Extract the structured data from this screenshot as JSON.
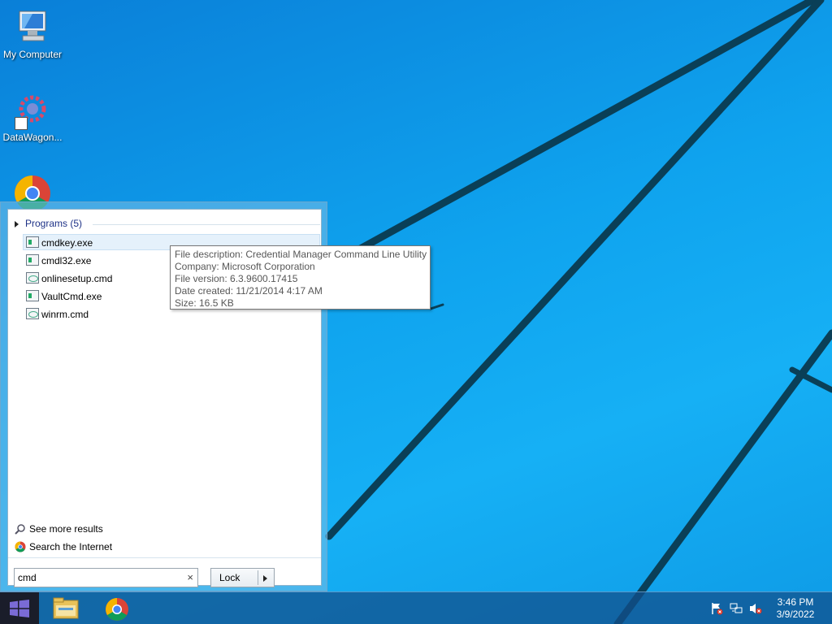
{
  "desktop": {
    "icons": [
      {
        "label": "My Computer",
        "icon": "computer-icon"
      },
      {
        "label": "DataWagon...",
        "icon": "gear-shortcut-icon"
      },
      {
        "label": "",
        "icon": "chrome-icon"
      }
    ]
  },
  "start_menu": {
    "programs_header": "Programs (5)",
    "programs": [
      {
        "label": "cmdkey.exe",
        "icon": "exe-icon",
        "selected": true
      },
      {
        "label": "cmdl32.exe",
        "icon": "exe-icon"
      },
      {
        "label": "onlinesetup.cmd",
        "icon": "cmd-script-icon"
      },
      {
        "label": "VaultCmd.exe",
        "icon": "exe-icon"
      },
      {
        "label": "winrm.cmd",
        "icon": "cmd-script-icon"
      }
    ],
    "tooltip": {
      "description": "File description: Credential Manager Command Line Utility",
      "company": "Company: Microsoft Corporation",
      "version": "File version: 6.3.9600.17415",
      "created": "Date created: 11/21/2014 4:17 AM",
      "size": "Size: 16.5 KB"
    },
    "see_more": "See more results",
    "search_internet": "Search the Internet",
    "search_value": "cmd",
    "clear_symbol": "×",
    "lock_label": "Lock"
  },
  "taskbar": {
    "apps": [
      "file-explorer-icon",
      "chrome-icon"
    ],
    "tray_icons": [
      "action-center-flag-icon",
      "network-icon",
      "volume-muted-icon"
    ],
    "time": "3:46 PM",
    "date": "3/9/2022"
  },
  "colors": {
    "wallpaper": "#0fa3ee",
    "programs_header": "#1e3287",
    "taskbar": "#12508c"
  }
}
